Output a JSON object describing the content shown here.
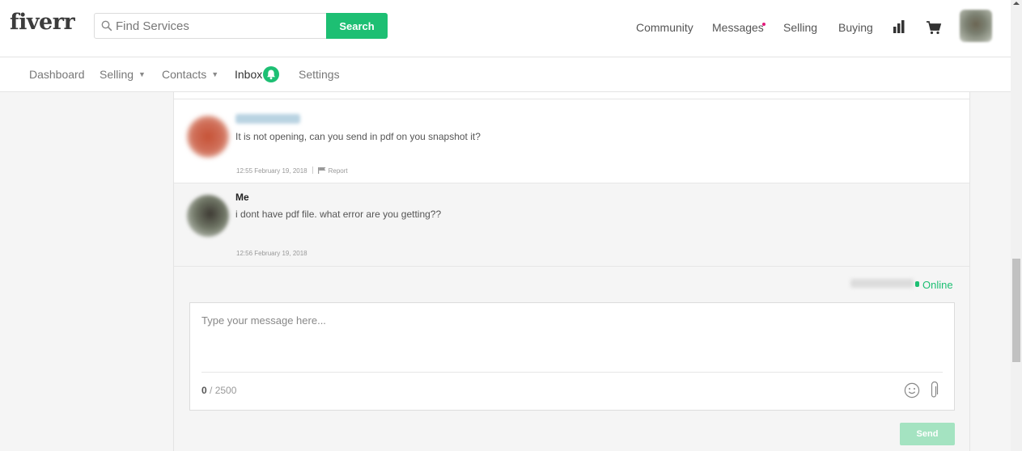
{
  "header": {
    "logo": "fiverr",
    "search": {
      "placeholder": "Find Services",
      "button_label": "Search"
    },
    "nav": {
      "community": "Community",
      "messages": "Messages",
      "selling": "Selling",
      "buying": "Buying"
    },
    "icons": [
      "search-icon",
      "notification-dot",
      "stats-icon",
      "cart-icon",
      "avatar"
    ]
  },
  "subnav": {
    "items": [
      {
        "label": "Dashboard",
        "dropdown": false
      },
      {
        "label": "Selling",
        "dropdown": true
      },
      {
        "label": "Contacts",
        "dropdown": true
      },
      {
        "label": "Inbox",
        "dropdown": false,
        "active": true
      },
      {
        "label": "Settings",
        "dropdown": false
      }
    ],
    "chevron": "⌄"
  },
  "conversation": {
    "messages": [
      {
        "sender": "",
        "text": "It is not opening, can you send in pdf on you snapshot it?",
        "time": "12:55 February 19, 2018",
        "report": "Report"
      },
      {
        "sender": "Me",
        "text": "i dont have pdf file. what error are you getting??",
        "time": "12:56 February 19, 2018"
      }
    ]
  },
  "compose": {
    "status": "Online",
    "placeholder": "Type your message here...",
    "char_count": "0",
    "char_limit": " / 2500",
    "send_label": "Send"
  },
  "colors": {
    "brand_green": "#1dbf73",
    "notification": "#e2197a",
    "send_disabled": "#a4e3c1"
  }
}
